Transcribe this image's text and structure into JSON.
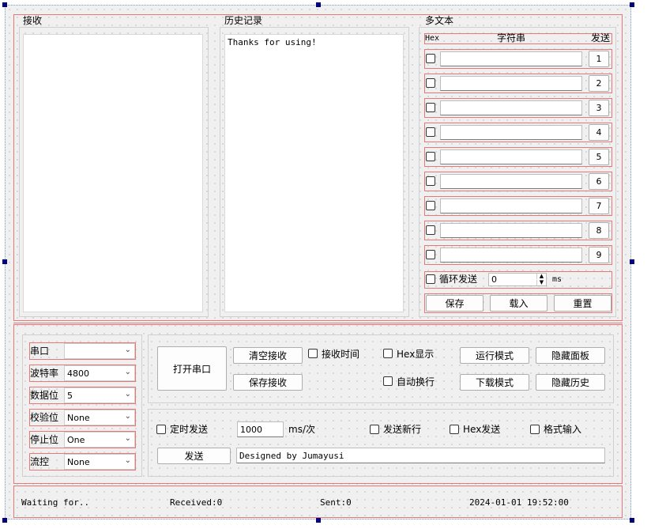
{
  "receive": {
    "title": "接收"
  },
  "history": {
    "title": "历史记录",
    "content": "Thanks for using!"
  },
  "multi_text": {
    "title": "多文本",
    "headers": {
      "hex": "Hex",
      "string": "字符串",
      "send": "发送"
    },
    "rows": [
      {
        "send_label": "1"
      },
      {
        "send_label": "2"
      },
      {
        "send_label": "3"
      },
      {
        "send_label": "4"
      },
      {
        "send_label": "5"
      },
      {
        "send_label": "6"
      },
      {
        "send_label": "7"
      },
      {
        "send_label": "8"
      },
      {
        "send_label": "9"
      }
    ],
    "loop_send_label": "循环发送",
    "loop_interval_value": "0",
    "loop_unit": "ms",
    "save_label": "保存",
    "load_label": "载入",
    "reset_label": "重置"
  },
  "serial_config": {
    "port": {
      "label": "串口",
      "value": ""
    },
    "baud": {
      "label": "波特率",
      "value": "4800"
    },
    "data_bits": {
      "label": "数据位",
      "value": "5"
    },
    "parity": {
      "label": "校验位",
      "value": "None"
    },
    "stop_bits": {
      "label": "停止位",
      "value": "One"
    },
    "flow": {
      "label": "流控",
      "value": "None"
    }
  },
  "controls": {
    "open_port_label": "打开串口",
    "clear_receive_label": "清空接收",
    "save_receive_label": "保存接收",
    "receive_time_label": "接收时间",
    "hex_display_label": "Hex显示",
    "auto_newline_label": "自动换行",
    "run_mode_label": "运行模式",
    "download_mode_label": "下载模式",
    "hide_panel_label": "隐藏面板",
    "hide_history_label": "隐藏历史"
  },
  "send": {
    "timed_send_label": "定时发送",
    "interval_value": "1000",
    "interval_unit": "ms/次",
    "send_newline_label": "发送新行",
    "hex_send_label": "Hex发送",
    "format_input_label": "格式输入",
    "send_button_label": "发送",
    "send_text_value": "Designed by Jumayusi"
  },
  "status": {
    "waiting": "Waiting for..",
    "received": "Received:0",
    "sent": "Sent:0",
    "time": "2024-01-01 19:52:00"
  },
  "colors": {
    "layout_border": "#e87878",
    "selection_handle": "#000080"
  }
}
